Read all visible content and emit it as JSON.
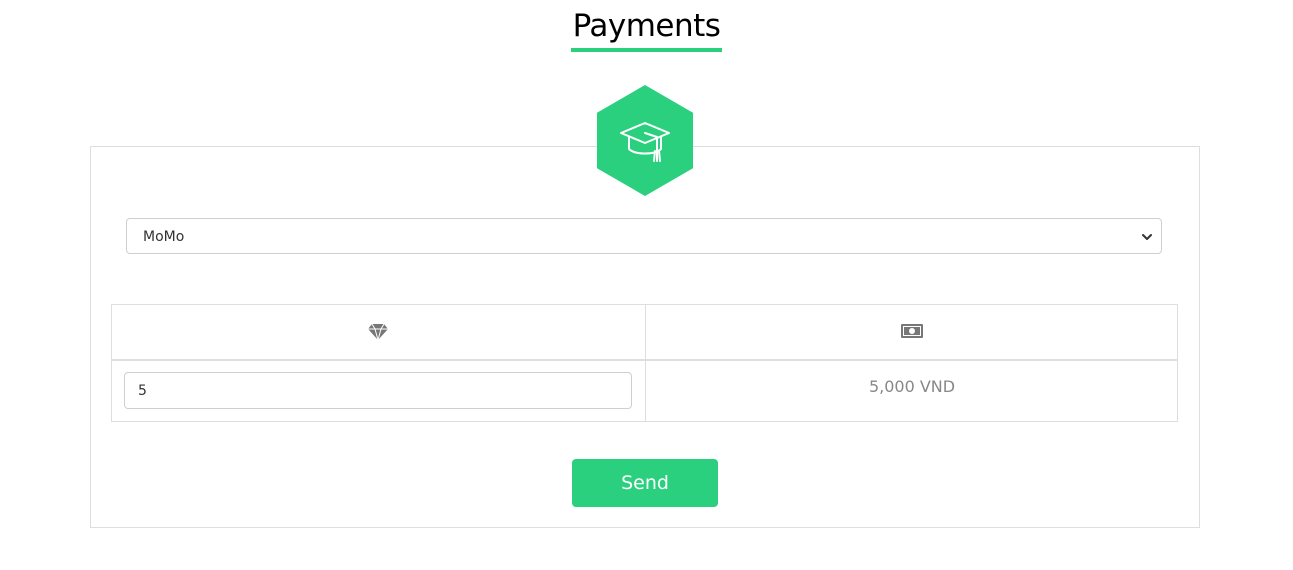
{
  "header": {
    "title": "Payments"
  },
  "logo": {
    "icon": "graduation-cap-icon",
    "color": "#2bd07f"
  },
  "payment_method": {
    "selected": "MoMo",
    "options": [
      "MoMo"
    ]
  },
  "table": {
    "columns": [
      {
        "icon": "diamond-icon"
      },
      {
        "icon": "money-bill-icon"
      }
    ],
    "quantity_value": "5",
    "price_text": "5,000 VND"
  },
  "actions": {
    "send_label": "Send"
  },
  "colors": {
    "accent": "#2bd07f",
    "border": "#dedede",
    "muted_text": "#888888"
  }
}
